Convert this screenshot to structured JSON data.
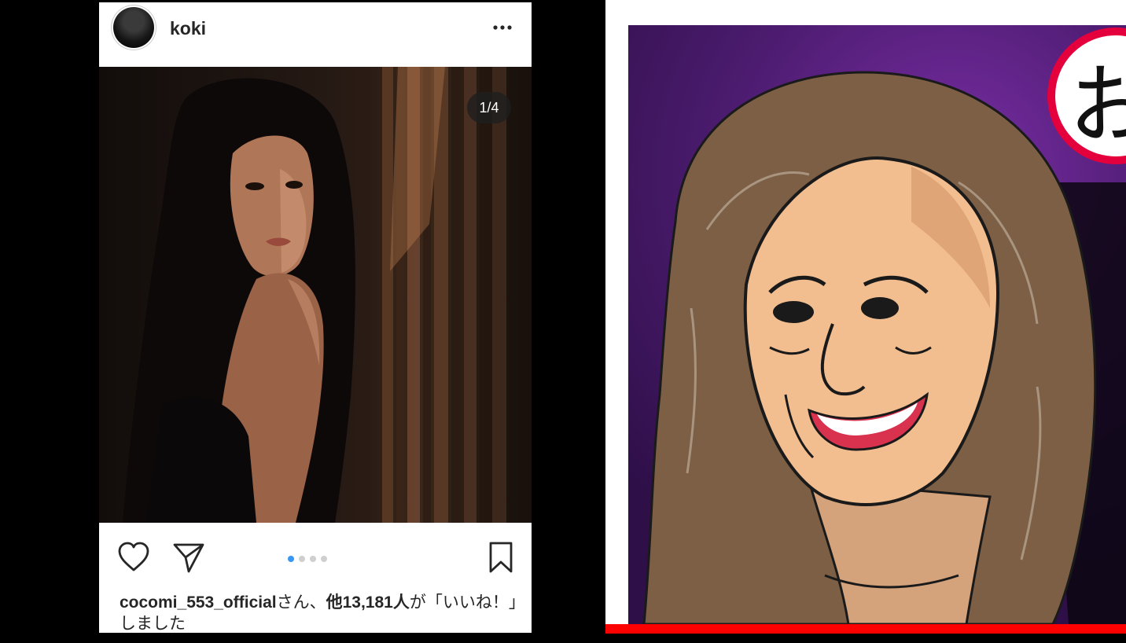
{
  "post": {
    "username": "koki",
    "image_counter": "1/4",
    "carousel_dots": 4,
    "active_dot_index": 0,
    "likes_username": "cocomi_553_official",
    "likes_suffix": "さん、",
    "likes_count": "他13,181人",
    "likes_tail": "が「いいね！」しました"
  },
  "thumbnail": {
    "corner_character": "お"
  },
  "colors": {
    "active_dot": "#3897f0",
    "accent_red": "#ff0000",
    "badge_ring": "#e3003c",
    "background_purple": "#5a1f86"
  }
}
